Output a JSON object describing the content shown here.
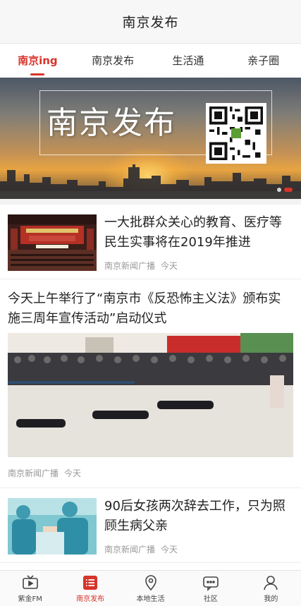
{
  "header": {
    "title": "南京发布"
  },
  "tabs": [
    {
      "label": "南京ing",
      "active": true
    },
    {
      "label": "南京发布",
      "active": false
    },
    {
      "label": "生活通",
      "active": false
    },
    {
      "label": "亲子圈",
      "active": false
    }
  ],
  "banner": {
    "brand_text": "南京发布",
    "slide_index": 2,
    "slide_count": 2
  },
  "feed": [
    {
      "title": "一大批群众关心的教育、医疗等民生实事将在2019年推进",
      "source": "南京新闻广播",
      "time": "今天"
    },
    {
      "title": "今天上午举行了“南京市《反恐怖主义法》颁布实施三周年宣传活动”启动仪式",
      "source": "南京新闻广播",
      "time": "今天"
    },
    {
      "title": "90后女孩两次辞去工作，只为照顾生病父亲",
      "source": "南京新闻广播",
      "time": "今天"
    }
  ],
  "bottom_nav": [
    {
      "label": "紫金FM",
      "icon": "tv-icon",
      "active": false
    },
    {
      "label": "南京发布",
      "icon": "list-icon",
      "active": true
    },
    {
      "label": "本地生活",
      "icon": "location-pin-icon",
      "active": false
    },
    {
      "label": "社区",
      "icon": "chat-bubble-icon",
      "active": false
    },
    {
      "label": "我的",
      "icon": "person-icon",
      "active": false
    }
  ],
  "colors": {
    "accent": "#d7342b",
    "text": "#222222",
    "meta": "#999999"
  }
}
